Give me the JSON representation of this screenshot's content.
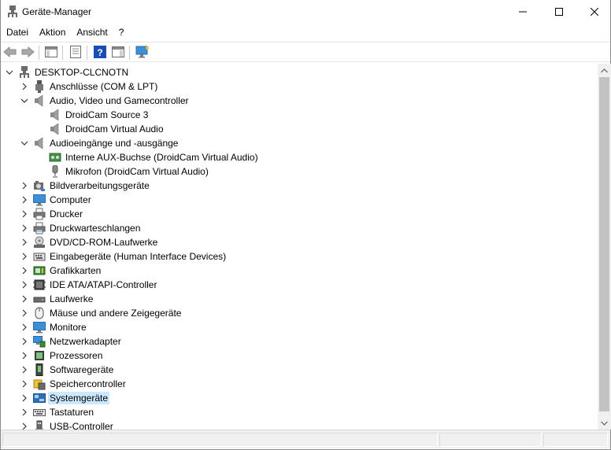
{
  "window": {
    "title": "Geräte-Manager",
    "icon": "device-manager-icon"
  },
  "menu": {
    "items": [
      "Datei",
      "Aktion",
      "Ansicht",
      "?"
    ]
  },
  "toolbar": {
    "buttons": [
      "back-arrow-icon",
      "forward-arrow-icon",
      "show-hide-console-tree-icon",
      "properties-icon",
      "help-icon",
      "action-pane-icon",
      "scan-hardware-monitor-icon"
    ]
  },
  "tree": {
    "root": "DESKTOP-CLCNOTN",
    "items": [
      {
        "label": "Anschlüsse (COM & LPT)",
        "icon": "port-icon",
        "state": "collapsed",
        "level": 1
      },
      {
        "label": "Audio, Video und Gamecontroller",
        "icon": "speaker-icon",
        "state": "expanded",
        "level": 1
      },
      {
        "label": "DroidCam Source 3",
        "icon": "speaker-icon",
        "state": "none",
        "level": 2
      },
      {
        "label": "DroidCam Virtual Audio",
        "icon": "speaker-icon",
        "state": "none",
        "level": 2
      },
      {
        "label": "Audioeingänge und -ausgänge",
        "icon": "speaker-icon",
        "state": "expanded",
        "level": 1
      },
      {
        "label": "Interne AUX-Buchse (DroidCam Virtual Audio)",
        "icon": "audio-jack-icon",
        "state": "none",
        "level": 2
      },
      {
        "label": "Mikrofon (DroidCam Virtual Audio)",
        "icon": "microphone-icon",
        "state": "none",
        "level": 2
      },
      {
        "label": "Bildverarbeitungsgeräte",
        "icon": "camera-icon",
        "state": "collapsed",
        "level": 1
      },
      {
        "label": "Computer",
        "icon": "monitor-icon",
        "state": "collapsed",
        "level": 1
      },
      {
        "label": "Drucker",
        "icon": "printer-icon",
        "state": "collapsed",
        "level": 1
      },
      {
        "label": "Druckwarteschlangen",
        "icon": "print-queue-icon",
        "state": "collapsed",
        "level": 1
      },
      {
        "label": "DVD/CD-ROM-Laufwerke",
        "icon": "disc-drive-icon",
        "state": "collapsed",
        "level": 1
      },
      {
        "label": "Eingabegeräte (Human Interface Devices)",
        "icon": "hid-icon",
        "state": "collapsed",
        "level": 1
      },
      {
        "label": "Grafikkarten",
        "icon": "graphics-card-icon",
        "state": "collapsed",
        "level": 1
      },
      {
        "label": "IDE ATA/ATAPI-Controller",
        "icon": "ide-controller-icon",
        "state": "collapsed",
        "level": 1
      },
      {
        "label": "Laufwerke",
        "icon": "disk-drive-icon",
        "state": "collapsed",
        "level": 1
      },
      {
        "label": "Mäuse und andere Zeigegeräte",
        "icon": "mouse-icon",
        "state": "collapsed",
        "level": 1
      },
      {
        "label": "Monitore",
        "icon": "monitor-icon",
        "state": "collapsed",
        "level": 1
      },
      {
        "label": "Netzwerkadapter",
        "icon": "network-adapter-icon",
        "state": "collapsed",
        "level": 1
      },
      {
        "label": "Prozessoren",
        "icon": "processor-icon",
        "state": "collapsed",
        "level": 1
      },
      {
        "label": "Softwaregeräte",
        "icon": "software-device-icon",
        "state": "collapsed",
        "level": 1
      },
      {
        "label": "Speichercontroller",
        "icon": "storage-controller-icon",
        "state": "collapsed",
        "level": 1
      },
      {
        "label": "Systemgeräte",
        "icon": "system-device-icon",
        "state": "collapsed",
        "level": 1,
        "selected": true
      },
      {
        "label": "Tastaturen",
        "icon": "keyboard-icon",
        "state": "collapsed",
        "level": 1
      },
      {
        "label": "USB-Controller",
        "icon": "usb-icon",
        "state": "collapsed",
        "level": 1
      }
    ]
  },
  "colors": {
    "selection": "#cce8ff",
    "scrollbar_thumb": "#c2c2c2",
    "help_blue": "#1a4db3"
  }
}
